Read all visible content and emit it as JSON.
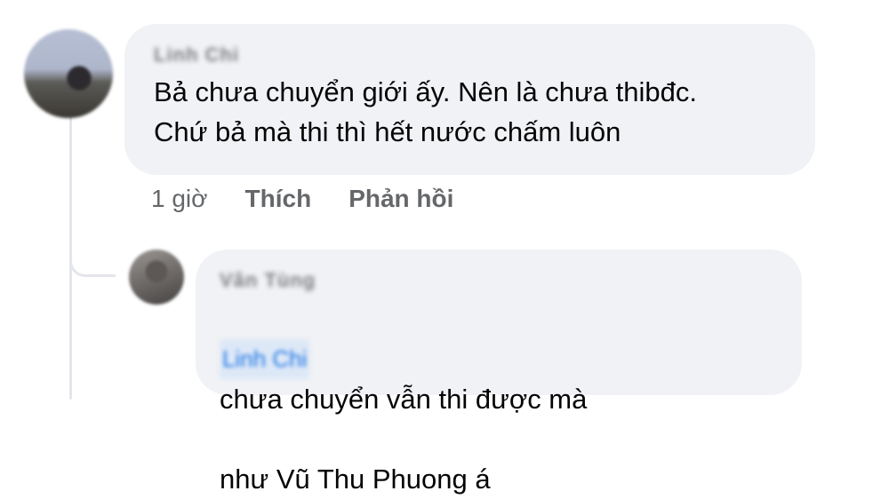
{
  "comment": {
    "author": "Linh Chi",
    "text": "Bả chưa chuyển giới ấy. Nên là chưa thibđc.\nChứ bả mà thi thì hết nước chấm luôn",
    "time": "1 giờ",
    "like_label": "Thích",
    "reply_label": "Phản hồi"
  },
  "reply": {
    "author": "Vân Tùng",
    "mention": "Linh Chi",
    "text_line1": "chưa chuyển vẫn thi được mà",
    "text_line2": "như Vũ Thu Phuong á"
  },
  "colors": {
    "bubble": "#f0f2f5",
    "meta_text": "#65676b",
    "mention": "#1b74e4"
  }
}
